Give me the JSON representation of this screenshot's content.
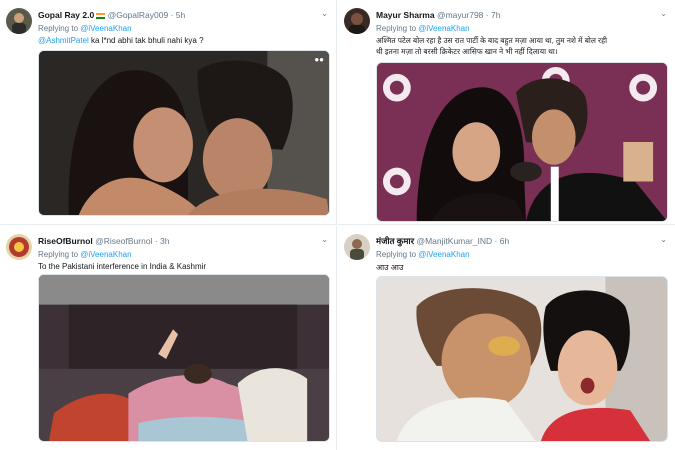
{
  "tweets": [
    {
      "name": "Gopal Ray 2.0",
      "handle": "@GopalRay009",
      "time": "5h",
      "replying_to_label": "Replying to",
      "replying_to": "@iVeenaKhan",
      "text_mention": "@AshmitPatel",
      "text": " ka l*nd abhi tak bhuli nahi kya ?"
    },
    {
      "name": "Mayur Sharma",
      "handle": "@mayur798",
      "time": "7h",
      "replying_to_label": "Replying to",
      "replying_to": "@iVeenaKhan",
      "text_line1": "अश्मित पटेल बोल रहा है उस रात पार्टी के बाद बहुत मज़ा आया था, तुम नशे में बोल रही",
      "text_line2": "थी इतना मज़ा तो बरसी क्रिकेटर आसिफ खान ने भी नहीं दिलाया था।"
    },
    {
      "name": "RiseOfBurnol",
      "handle": "@RiseofBurnol",
      "time": "3h",
      "replying_to_label": "Replying to",
      "replying_to": "@iVeenaKhan",
      "text": "To the Pakistani interference in India & Kashmir"
    },
    {
      "name": "मंजीत कुमार",
      "handle": "@ManjitKumar_IND",
      "time": "6h",
      "replying_to_label": "Replying to",
      "replying_to": "@iVeenaKhan",
      "text": "आउ आउ"
    }
  ],
  "icons": {
    "chevron": "chevron-down-icon",
    "flag": "india-flag-icon"
  },
  "dot": "·"
}
